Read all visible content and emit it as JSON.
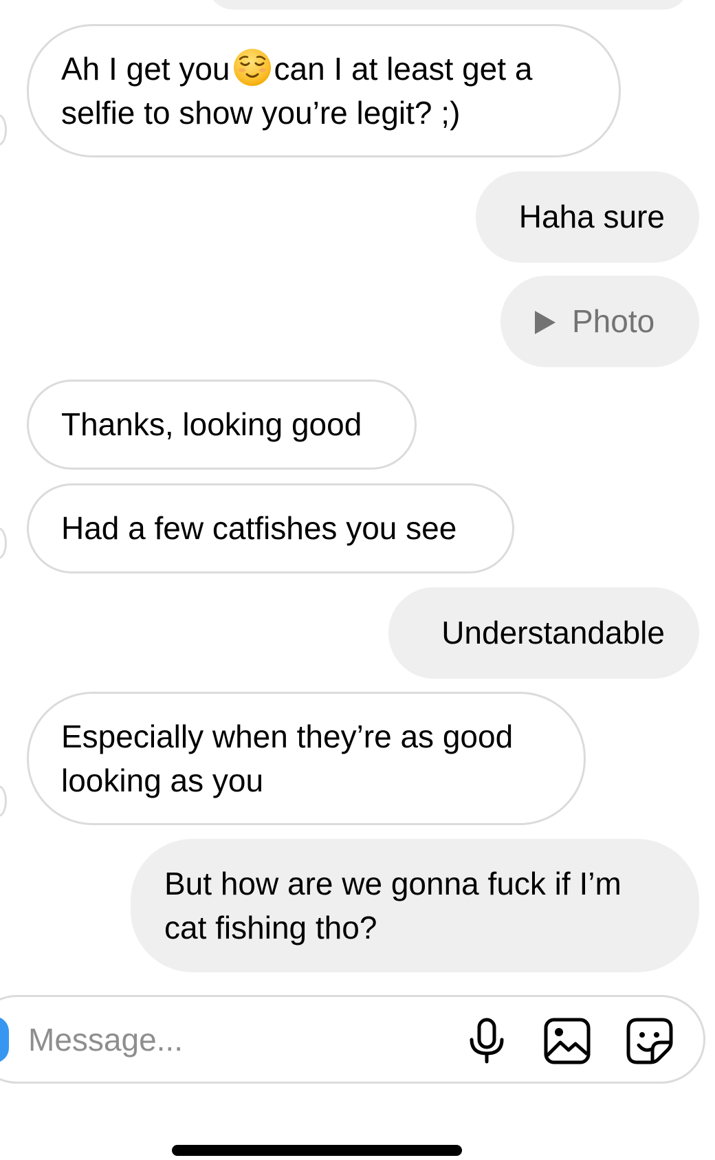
{
  "conversation": {
    "messages": [
      {
        "from": "them",
        "line1_a": "Ah I get you",
        "emoji": "relieved-face",
        "line1_b": "can I at least get a",
        "line2": "selfie to show you’re legit? ;)"
      },
      {
        "from": "me",
        "text": "Haha sure"
      },
      {
        "from": "me",
        "type": "photo",
        "text": "Photo"
      },
      {
        "from": "them",
        "text": "Thanks, looking good"
      },
      {
        "from": "them",
        "text": "Had a few catfishes you see"
      },
      {
        "from": "me",
        "text": "Understandable"
      },
      {
        "from": "them",
        "line1": "Especially when they’re as good",
        "line2": "looking as you"
      },
      {
        "from": "me",
        "line1": "But how are we gonna fuck if I’m",
        "line2": "cat fishing tho?"
      }
    ]
  },
  "composer": {
    "placeholder": "Message...",
    "icons": [
      "camera-icon",
      "microphone-icon",
      "gallery-icon",
      "sticker-icon"
    ]
  },
  "colors": {
    "sent_bubble": "#efefef",
    "received_border": "#dbdbdb",
    "accent": "#3797f0",
    "muted_text": "#8e8e8e"
  }
}
